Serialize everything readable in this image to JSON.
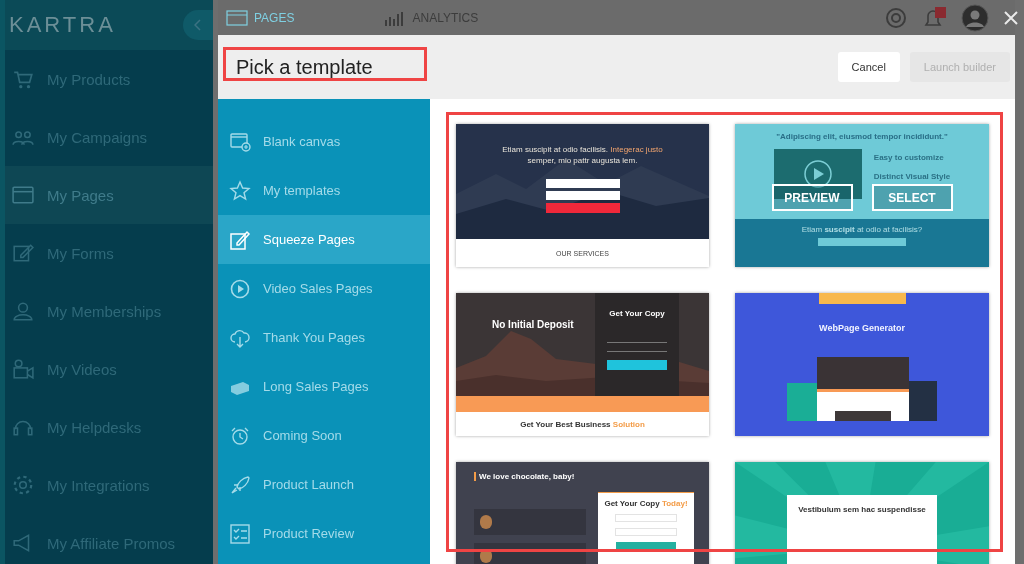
{
  "app": {
    "logo": "KARTRA",
    "nav": [
      {
        "label": "My Products",
        "selected": false
      },
      {
        "label": "My Campaigns",
        "selected": false
      },
      {
        "label": "My Pages",
        "selected": true
      },
      {
        "label": "My Forms",
        "selected": false
      },
      {
        "label": "My Memberships",
        "selected": false
      },
      {
        "label": "My Videos",
        "selected": false
      },
      {
        "label": "My Helpdesks",
        "selected": false
      },
      {
        "label": "My Integrations",
        "selected": false
      },
      {
        "label": "My Affiliate Promos",
        "selected": false
      }
    ],
    "top_tabs": [
      {
        "label": "PAGES",
        "selected": true
      },
      {
        "label": "ANALYTICS",
        "selected": false
      }
    ]
  },
  "modal": {
    "title": "Pick a template",
    "buttons": [
      {
        "label": "Cancel",
        "disabled": false
      },
      {
        "label": "Launch builder",
        "disabled": true
      }
    ],
    "categories": [
      {
        "label": "Blank canvas",
        "selected": false
      },
      {
        "label": "My templates",
        "selected": false
      },
      {
        "label": "Squeeze Pages",
        "selected": true
      },
      {
        "label": "Video Sales Pages",
        "selected": false
      },
      {
        "label": "Thank You Pages",
        "selected": false
      },
      {
        "label": "Long Sales Pages",
        "selected": false
      },
      {
        "label": "Coming Soon",
        "selected": false
      },
      {
        "label": "Product Launch",
        "selected": false
      },
      {
        "label": "Product Review",
        "selected": false
      }
    ],
    "templates": [
      {
        "kind": "hero-form",
        "hovered": false,
        "heading_parts": [
          {
            "text": "Etiam suscipit at odio facilisis.",
            "accent": false
          },
          {
            "text": "Integerac justo",
            "accent": true
          },
          {
            "text": "semper, mio pattr augusta lem.",
            "accent": false
          }
        ],
        "footer": "OUR SERVICES"
      },
      {
        "kind": "video-features",
        "hovered": true,
        "quote": "\"Adipiscing elit, eiusmod tempor incididunt.\"",
        "features": [
          "Easy to customize",
          "Distinct Visual Style"
        ],
        "question": "Etiam **suscipit** at odio at facilisis?",
        "actions": [
          "PREVIEW",
          "SELECT"
        ]
      },
      {
        "kind": "split-form",
        "hovered": false,
        "heading": "No Initial Deposit",
        "form_title": "Get Your Copy",
        "footer_parts": [
          {
            "text": "Get Your Best Business",
            "accent": false
          },
          {
            "text": "Solution",
            "accent": true
          }
        ]
      },
      {
        "kind": "generator",
        "hovered": false,
        "heading": "WebPage Generator"
      },
      {
        "kind": "testimonial-form",
        "hovered": false,
        "heading": "We love chocolate, baby!",
        "form_title_parts": [
          {
            "text": "Get Your Copy",
            "accent": false
          },
          {
            "text": "Today!",
            "accent": true
          }
        ]
      },
      {
        "kind": "sunburst-form",
        "hovered": false,
        "heading": "Vestibulum sem hac suspendisse"
      }
    ]
  }
}
